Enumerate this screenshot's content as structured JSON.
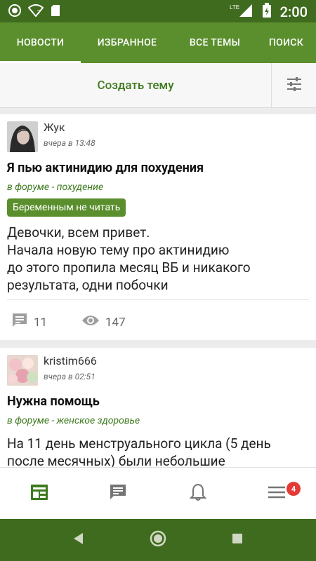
{
  "status_bar": {
    "time": "2:00",
    "network": "LTE"
  },
  "tabs": [
    {
      "label": "НОВОСТИ",
      "active": true
    },
    {
      "label": "ИЗБРАННОЕ",
      "active": false
    },
    {
      "label": "ВСЕ ТЕМЫ",
      "active": false
    },
    {
      "label": "ПОИСК",
      "active": false
    }
  ],
  "action_bar": {
    "create_label": "Создать тему",
    "filter_icon": "tune-icon"
  },
  "posts": [
    {
      "author": "Жук",
      "time": "вчера в 13:48",
      "title": "Я пью актинидию для похудения",
      "forum": "в форуме - похудение",
      "tag": "Беременным не читать",
      "body": "Девочки, всем привет.\nНачала новую тему про актинидию\nдо этого пропила месяц ВБ и никакого результата, одни побочки",
      "comments": "11",
      "views": "147"
    },
    {
      "author": "kristim666",
      "time": "вчера в 02:51",
      "title": "Нужна помощь",
      "forum": "в форуме - женское здоровье",
      "body": "На 11 день менструального цикла (5 день после месячных) были небольшие"
    }
  ],
  "bottom_nav": {
    "items": [
      "news-feed-icon",
      "messages-icon",
      "notifications-icon",
      "menu-icon"
    ],
    "menu_badge": "4"
  },
  "colors": {
    "primary": "#5b8f2e",
    "primary_dark": "#3f6b1e",
    "accent_text": "#3e7a1e",
    "badge": "#e53935"
  }
}
